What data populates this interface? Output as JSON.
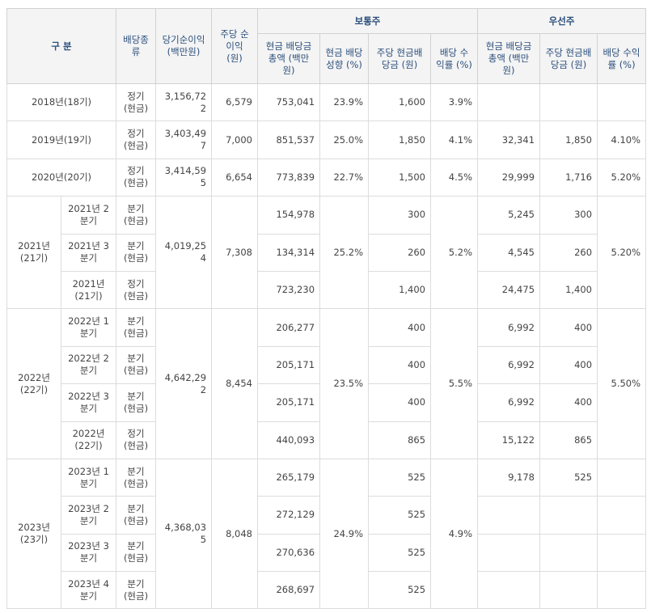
{
  "header": {
    "division": "구  분",
    "dividend_type": "배당종류",
    "net_income": "당기순이익 (백만원)",
    "eps": "주당 순이익 (원)",
    "common": "보통주",
    "preferred": "우선주",
    "common_cols": [
      "현금 배당금 총액 (백만원)",
      "현금 배당 성향 (%)",
      "주당 현금배당금 (원)",
      "배당 수익률 (%)"
    ],
    "preferred_cols": [
      "현금 배당금 총액 (백만원)",
      "주당 현금배당금 (원)",
      "배당 수익률 (%)"
    ]
  },
  "rows": [
    {
      "year": "2018년(18기)",
      "type": "정기 (현금)",
      "net_income": "3,156,722",
      "eps": "6,579",
      "c_total": "753,041",
      "c_payout": "23.9%",
      "c_dps": "1,600",
      "c_yield": "3.9%",
      "p_total": "",
      "p_dps": "",
      "p_yield": ""
    },
    {
      "year": "2019년(19기)",
      "type": "정기 (현금)",
      "net_income": "3,403,497",
      "eps": "7,000",
      "c_total": "851,537",
      "c_payout": "25.0%",
      "c_dps": "1,850",
      "c_yield": "4.1%",
      "p_total": "32,341",
      "p_dps": "1,850",
      "p_yield": "4.10%"
    },
    {
      "year": "2020년(20기)",
      "type": "정기 (현금)",
      "net_income": "3,414,595",
      "eps": "6,654",
      "c_total": "773,839",
      "c_payout": "22.7%",
      "c_dps": "1,500",
      "c_yield": "4.5%",
      "p_total": "29,999",
      "p_dps": "1,716",
      "p_yield": "5.20%"
    }
  ],
  "groups": [
    {
      "year": "2021년 (21기)",
      "net_income": "4,019,254",
      "eps": "7,308",
      "c_payout": "25.2%",
      "c_yield": "5.2%",
      "p_yield": "5.20%",
      "sub": [
        {
          "period": "2021년 2 분기",
          "type": "분기 (현금)",
          "c_total": "154,978",
          "c_dps": "300",
          "p_total": "5,245",
          "p_dps": "300"
        },
        {
          "period": "2021년 3 분기",
          "type": "분기 (현금)",
          "c_total": "134,314",
          "c_dps": "260",
          "p_total": "4,545",
          "p_dps": "260"
        },
        {
          "period": "2021년 (21기)",
          "type": "정기 (현금)",
          "c_total": "723,230",
          "c_dps": "1,400",
          "p_total": "24,475",
          "p_dps": "1,400"
        }
      ]
    },
    {
      "year": "2022년 (22기)",
      "net_income": "4,642,292",
      "eps": "8,454",
      "c_payout": "23.5%",
      "c_yield": "5.5%",
      "p_yield": "5.50%",
      "sub": [
        {
          "period": "2022년 1 분기",
          "type": "분기 (현금)",
          "c_total": "206,277",
          "c_dps": "400",
          "p_total": "6,992",
          "p_dps": "400"
        },
        {
          "period": "2022년 2 분기",
          "type": "분기 (현금)",
          "c_total": "205,171",
          "c_dps": "400",
          "p_total": "6,992",
          "p_dps": "400"
        },
        {
          "period": "2022년 3 분기",
          "type": "분기 (현금)",
          "c_total": "205,171",
          "c_dps": "400",
          "p_total": "6,992",
          "p_dps": "400"
        },
        {
          "period": "2022년 (22기)",
          "type": "정기 (현금)",
          "c_total": "440,093",
          "c_dps": "865",
          "p_total": "15,122",
          "p_dps": "865"
        }
      ]
    },
    {
      "year": "2023년 (23기)",
      "net_income": "4,368,035",
      "eps": "8,048",
      "c_payout": "24.9%",
      "c_yield": "4.9%",
      "p_yield": "",
      "sub": [
        {
          "period": "2023년 1 분기",
          "type": "분기 (현금)",
          "c_total": "265,179",
          "c_dps": "525",
          "p_total": "9,178",
          "p_dps": "525"
        },
        {
          "period": "2023년 2 분기",
          "type": "분기 (현금)",
          "c_total": "272,129",
          "c_dps": "525",
          "p_total": "",
          "p_dps": ""
        },
        {
          "period": "2023년 3 분기",
          "type": "분기 (현금)",
          "c_total": "270,636",
          "c_dps": "525",
          "p_total": "",
          "p_dps": ""
        },
        {
          "period": "2023년 4 분기",
          "type": "분기 (현금)",
          "c_total": "268,697",
          "c_dps": "525",
          "p_total": "",
          "p_dps": ""
        }
      ]
    }
  ]
}
